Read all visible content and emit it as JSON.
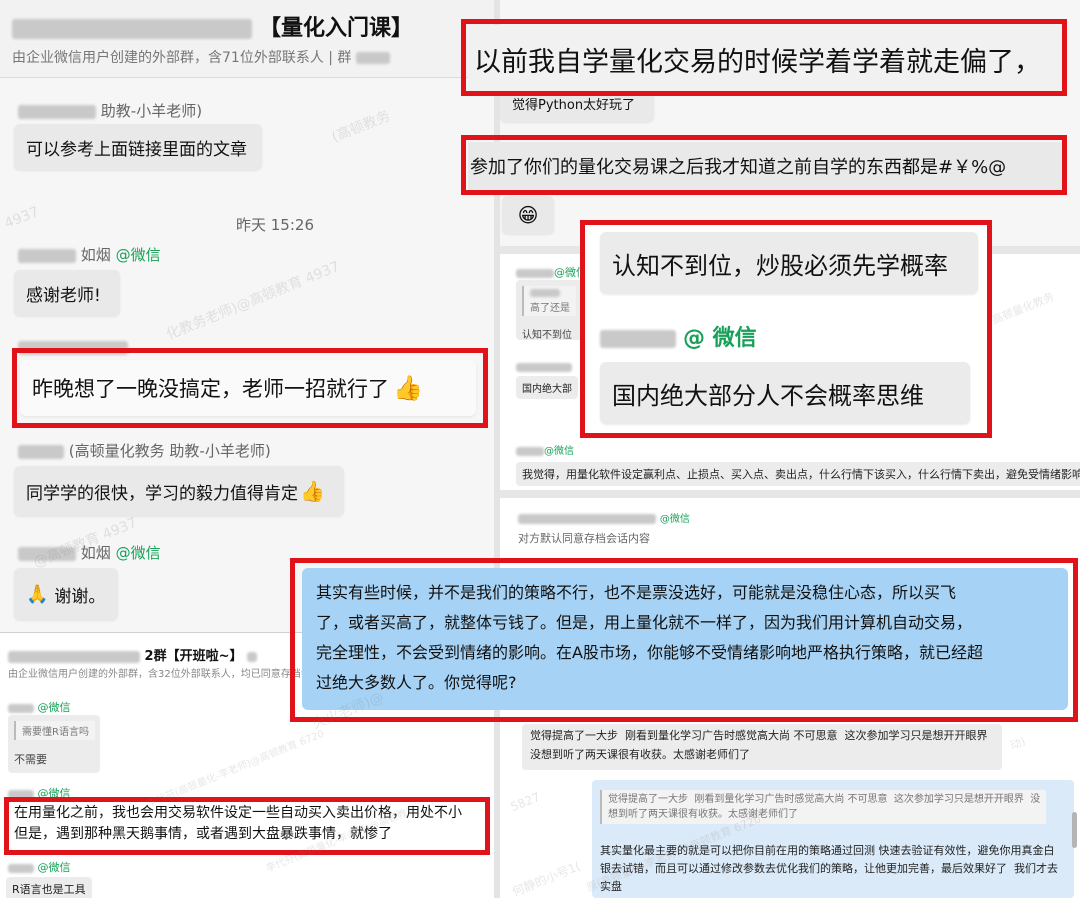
{
  "left_top": {
    "group_title": "【量化入门课】",
    "group_subtitle": "由企业微信用户创建的外部群，含71位外部联系人 | 群",
    "msgs": [
      {
        "name": "助教-小羊老师)",
        "text": "可以参考上面链接里面的文章"
      },
      {
        "time": "昨天 15:26"
      },
      {
        "name": "如烟",
        "wx": "@微信",
        "text": "感谢老师!"
      },
      {
        "text": "昨晚想了一晚没搞定，老师一招就行了",
        "emoji": "👍"
      },
      {
        "name": "(高顿量化教务 助教-小羊老师)",
        "text": "同学学的很快，学习的毅力值得肯定",
        "emoji": "👍"
      },
      {
        "name": "如烟",
        "wx": "@微信",
        "text": "谢谢。",
        "emoji": "🙏"
      }
    ]
  },
  "left_bottom": {
    "group_title": "2群【开班啦~】",
    "group_subtitle": "由企业微信用户创建的外部群，含32位外部联系人，均已同意存档会话内",
    "wx1": "@微信",
    "quote1": "需要懂R语言吗",
    "reply1": "不需要",
    "wx2": "@微信",
    "highlight_text": "在用量化之前，我也会用交易软件设定一些自动买入卖出价格，用处不小\n但是，遇到那种黑天鹅事情，或者遇到大盘暴跌事情，就惨了",
    "wx3": "@微信",
    "last": "R语言也是工具"
  },
  "right_top": {
    "big1": "以前我自学量化交易的时候学着学着就走偏了，",
    "msg2": "觉得Python太好玩了",
    "big3": "参加了你们的量化交易课之后我才知道之前自学的东西都是#￥%@",
    "emoji4": "😁"
  },
  "right_mid": {
    "wx": "@微信",
    "quote_text": "高了还是",
    "q1": "认知不到位",
    "q2": "国内绝大部",
    "big_line1": "认知不到位，炒股必须先学概率",
    "big_wx": "@ 微信",
    "big_line2": "国内绝大部分人不会概率思维",
    "wx2": "@微信",
    "long": "我觉得，用量化软件设定赢利点、止损点、买入点、卖出点，什么行情下该买入，什么行情下卖出，避免受情绪影响"
  },
  "right_bottom": {
    "wx": "@微信",
    "consent": "对方默认同意存档会话内容",
    "blue_text": "其实有些时候，并不是我们的策略不行，也不是票没选好，可能就是没稳住心态，所以买飞\n了，或者买高了，就整体亏钱了。但是，用上量化就不一样了，因为我们用计算机自动交易，\n完全理性，不会受到情绪的影响。在A股市场，你能够不受情绪影响地严格执行策略，就已经超\n过绝大多数人了。你觉得呢?",
    "reply_text": "觉得提高了一大步  刚看到量化学习广告时感觉高大尚 不可思意  这次参加学习只是想开开眼界\n没想到听了两天课很有收获。太感谢老师们了",
    "quote_text": "觉得提高了一大步  刚看到量化学习广告时感觉高大尚 不可思意  这次参加学习只是想开开眼界  没\n想到听了两天课很有收获。太感谢老师们了",
    "teacher_text": "其实量化最主要的就是可以把你目前在用的策略通过回测 快速去验证有效性，避免你用真金白\n银去试错，而且可以通过修改参数去优化我们的策略，让他更加完善，最后效果好了  我们才去\n实盘"
  },
  "watermarks": [
    "(高顿教务",
    "(高顿量化教务老师)",
    "@高顿教育 4937",
    "4937",
    "化教务老师)@高顿教育 4937",
    "@高顿教育 4937",
    "化(高顿量化教务老师)",
    "(高顿量化教务老师)",
    "李代芬(高顿量化-李老师)@高顿教育 6720",
    "李代芬(高顿量化-李老师)@高顿教育",
    "火火老师)@",
    "5827",
    "何静的小号1(",
    "原(高顿量化-李老师)@高顿教育 6720",
    "教育 6720",
    "(高顿量化教",
    "动)",
    "火火",
    "高顿量化教务",
    "5827",
    "高顿的小号1(",
    "火火老师)@"
  ]
}
